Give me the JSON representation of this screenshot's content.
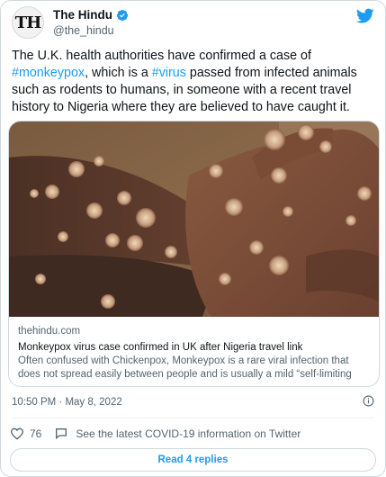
{
  "tweet": {
    "author": {
      "display_name": "The Hindu",
      "handle": "@the_hindu",
      "avatar_text": "TH",
      "verified": true
    },
    "text_parts": [
      {
        "text": "The U.K. health authorities have confirmed a case of ",
        "type": "text"
      },
      {
        "text": "#monkeypox",
        "type": "hashtag"
      },
      {
        "text": ", which is a ",
        "type": "text"
      },
      {
        "text": "#virus",
        "type": "hashtag"
      },
      {
        "text": " passed from infected animals such as rodents to humans, in someone with a recent travel history to Nigeria where they are believed to have caught it.",
        "type": "text"
      }
    ],
    "link_card": {
      "domain": "thehindu.com",
      "title": "Monkeypox virus case confirmed in UK after Nigeria travel link",
      "description": "Often confused with Chickenpox, Monkeypox is a rare viral infection that does not spread easily between people and is usually a mild “self-limiting illness” a…"
    },
    "timestamp": "10:50 PM · May 8, 2022",
    "likes": "76",
    "covid_notice": "See the latest COVID-19 information on Twitter",
    "read_replies_label": "Read 4 replies"
  },
  "icons": {
    "brand": "twitter-bird-icon",
    "verified": "verified-badge-icon",
    "like": "heart-icon",
    "covid": "speech-bubble-icon",
    "info": "info-icon"
  },
  "colors": {
    "accent": "#1d9bf0",
    "text": "#0f1419",
    "secondary": "#536471",
    "border": "#cfd9de"
  }
}
